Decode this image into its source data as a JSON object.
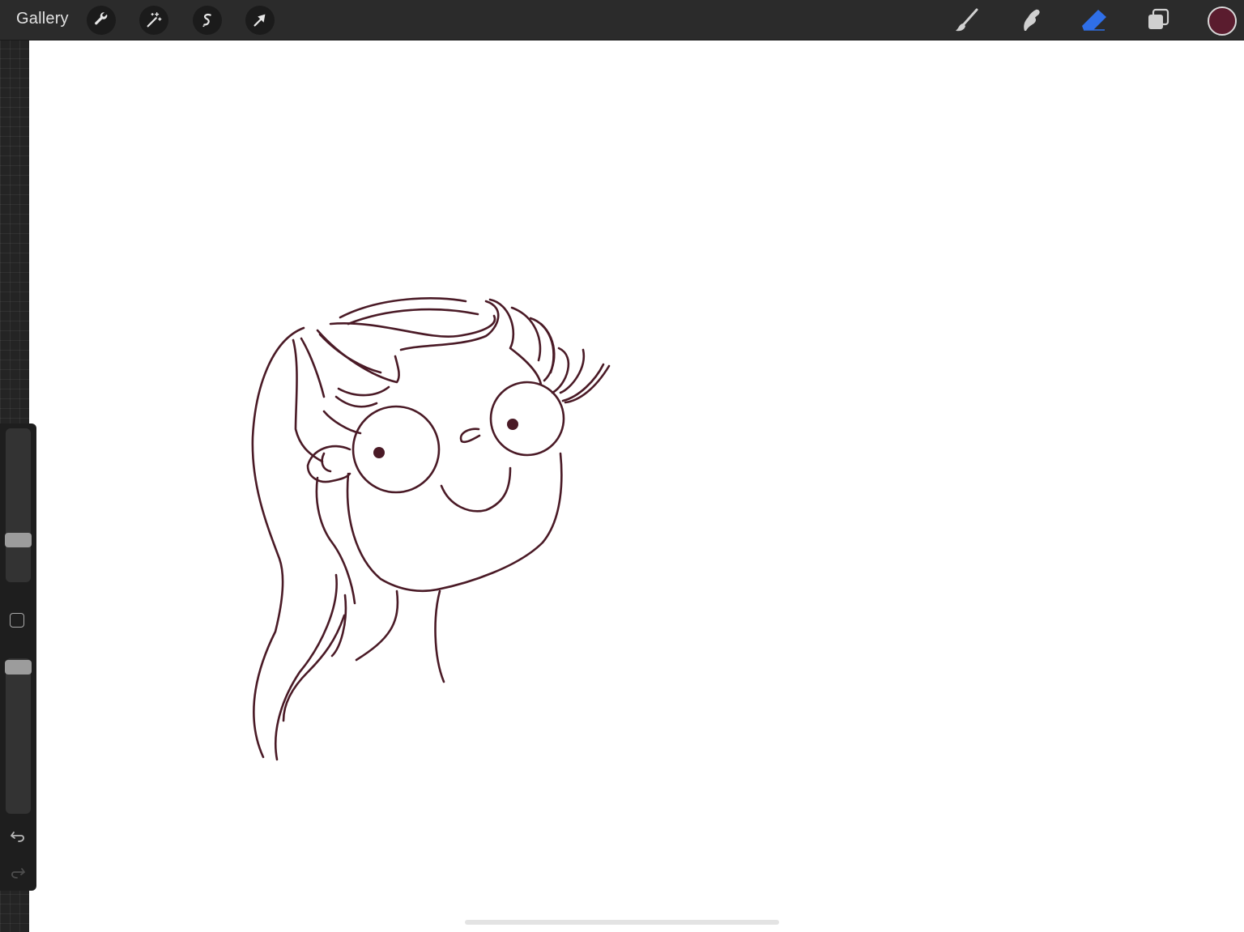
{
  "topbar": {
    "gallery_label": "Gallery",
    "left_tools": [
      "wrench-icon",
      "magic-wand-icon",
      "selection-icon",
      "transform-arrow-icon"
    ],
    "right_tools": [
      "brush-icon",
      "smudge-icon",
      "eraser-icon",
      "layers-icon"
    ],
    "active_tool": "eraser",
    "active_color": "#5a1c2e"
  },
  "sidebar": {
    "brush_size_level": 0.27,
    "opacity_level": 1.0,
    "modify_button": "square-icon",
    "undo": "undo-icon",
    "redo": "redo-icon"
  },
  "colors": {
    "accent": "#2f6fe8",
    "stroke": "#4a1a26"
  }
}
